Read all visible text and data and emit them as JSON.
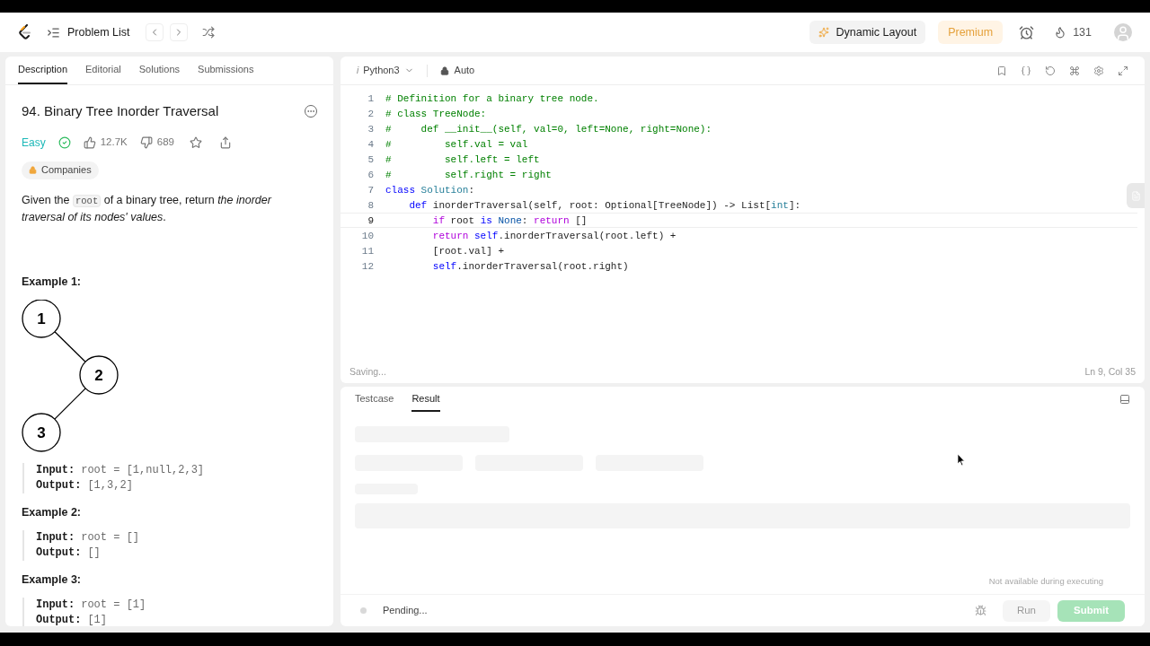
{
  "header": {
    "problem_list": "Problem List",
    "dynamic_layout": "Dynamic Layout",
    "premium": "Premium",
    "streak": "131"
  },
  "description_panel": {
    "tabs": [
      {
        "label": "Description",
        "selected": true
      },
      {
        "label": "Editorial",
        "selected": false
      },
      {
        "label": "Solutions",
        "selected": false
      },
      {
        "label": "Submissions",
        "selected": false
      }
    ],
    "title": "94. Binary Tree Inorder Traversal",
    "difficulty": "Easy",
    "solved": true,
    "likes": "12.7K",
    "dislikes": "689",
    "companies": "Companies",
    "statement": [
      {
        "kind": "text",
        "text": "Given the "
      },
      {
        "kind": "code",
        "text": "root"
      },
      {
        "kind": "text",
        "text": " of a binary tree, return "
      },
      {
        "kind": "italic",
        "text": "the inorder traversal of its nodes' values"
      },
      {
        "kind": "text",
        "text": "."
      }
    ],
    "examples": [
      {
        "title": "Example 1:",
        "tree_nodes": [
          "1",
          "2",
          "3"
        ],
        "input_label": "Input:",
        "input": "root = [1,null,2,3]",
        "output_label": "Output:",
        "output": "[1,3,2]"
      },
      {
        "title": "Example 2:",
        "input_label": "Input:",
        "input": "root = []",
        "output_label": "Output:",
        "output": "[]"
      },
      {
        "title": "Example 3:",
        "input_label": "Input:",
        "input": "root = [1]",
        "output_label": "Output:",
        "output": "[1]"
      }
    ]
  },
  "editor": {
    "language_icon": "i",
    "language": "Python3",
    "mode": "Auto",
    "status": "Saving...",
    "position": "Ln 9, Col 35",
    "lines": [
      {
        "number": "1",
        "current": false,
        "tokens": [
          {
            "kind": "comment",
            "text": "# Definition for a binary tree node."
          }
        ]
      },
      {
        "number": "2",
        "current": false,
        "tokens": [
          {
            "kind": "comment",
            "text": "# class TreeNode:"
          }
        ]
      },
      {
        "number": "3",
        "current": false,
        "tokens": [
          {
            "kind": "comment",
            "text": "#     def __init__(self, val=0, left=None, right=None):"
          }
        ]
      },
      {
        "number": "4",
        "current": false,
        "tokens": [
          {
            "kind": "comment",
            "text": "#         self.val = val"
          }
        ]
      },
      {
        "number": "5",
        "current": false,
        "tokens": [
          {
            "kind": "comment",
            "text": "#         self.left = left"
          }
        ]
      },
      {
        "number": "6",
        "current": false,
        "tokens": [
          {
            "kind": "comment",
            "text": "#         self.right = right"
          }
        ]
      },
      {
        "number": "7",
        "current": false,
        "tokens": [
          {
            "kind": "keyword",
            "text": "class"
          },
          {
            "kind": "type",
            "text": " Solution"
          },
          {
            "kind": "plain",
            "text": ":"
          }
        ]
      },
      {
        "number": "8",
        "current": false,
        "tokens": [
          {
            "kind": "keyword",
            "text": "    def"
          },
          {
            "kind": "plain",
            "text": " inorderTraversal(self, root: Optional[TreeNode]) -> List["
          },
          {
            "kind": "type",
            "text": "int"
          },
          {
            "kind": "plain",
            "text": "]:"
          }
        ]
      },
      {
        "number": "9",
        "current": true,
        "tokens": [
          {
            "kind": "control",
            "text": "        if"
          },
          {
            "kind": "plain",
            "text": " root "
          },
          {
            "kind": "keyword",
            "text": "is"
          },
          {
            "kind": "constant",
            "text": " None"
          },
          {
            "kind": "plain",
            "text": ": "
          },
          {
            "kind": "control",
            "text": "return"
          },
          {
            "kind": "plain",
            "text": " []"
          }
        ]
      },
      {
        "number": "10",
        "current": false,
        "tokens": [
          {
            "kind": "control",
            "text": "        return"
          },
          {
            "kind": "keyword",
            "text": " self"
          },
          {
            "kind": "plain",
            "text": ".inorderTraversal(root.left) +"
          }
        ]
      },
      {
        "number": "11",
        "current": false,
        "tokens": [
          {
            "kind": "plain",
            "text": "        [root.val] +"
          }
        ]
      },
      {
        "number": "12",
        "current": false,
        "tokens": [
          {
            "kind": "keyword",
            "text": "        self"
          },
          {
            "kind": "plain",
            "text": ".inorderTraversal(root.right)"
          }
        ]
      }
    ]
  },
  "result_panel": {
    "tabs": [
      {
        "label": "Testcase",
        "selected": false
      },
      {
        "label": "Result",
        "selected": true
      }
    ],
    "status": "Pending...",
    "tooltip": "Not available during executing",
    "run": "Run",
    "submit": "Submit",
    "submit_disabled": true
  }
}
